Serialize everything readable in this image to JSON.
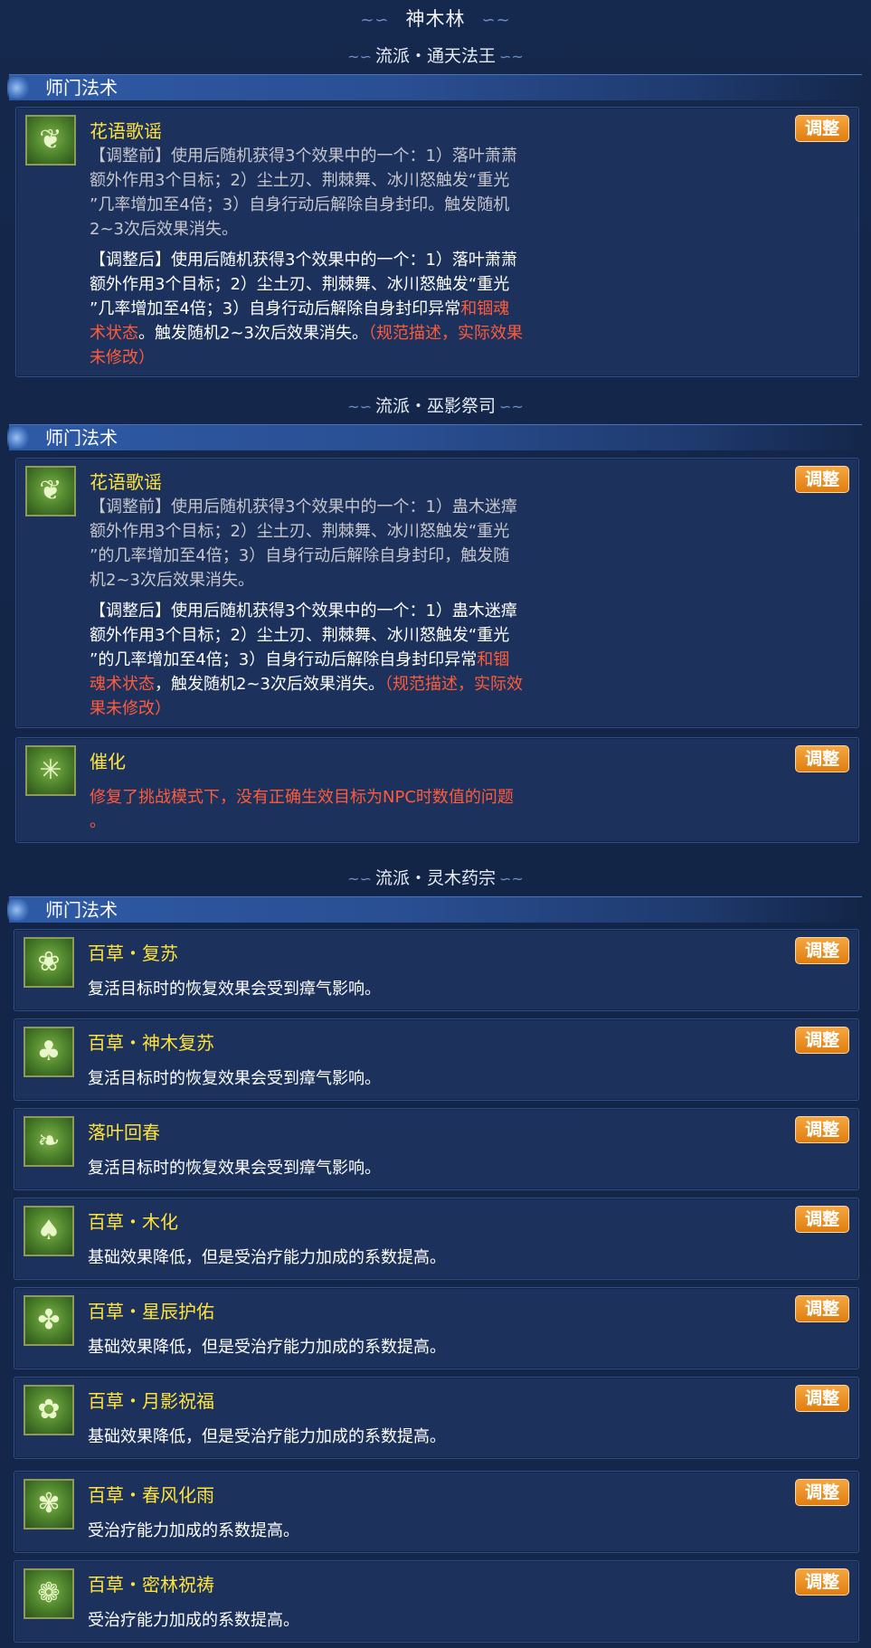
{
  "page_title": "神木林",
  "sections": [
    {
      "school": "流派・通天法王",
      "category": "师门法术",
      "skills": [
        {
          "name": "花语歌谣",
          "badge": "调整",
          "before_lines": [
            "【调整前】使用后随机获得3个效果中的一个：1）落叶萧萧",
            "额外作用3个目标；2）尘土刃、荆棘舞、冰川怒触发“重光",
            "”几率增加至4倍；3）自身行动后解除自身封印。触发随机",
            "2~3次后效果消失。"
          ],
          "after_lines": [
            "【调整后】使用后随机获得3个效果中的一个：1）落叶萧萧",
            "额外作用3个目标；2）尘土刃、荆棘舞、冰川怒触发“重光",
            "”几率增加至4倍；3）自身行动后解除自身封印异常"
          ],
          "after_red1": "和锢魂",
          "after_red2": "术状态",
          "after_tail": "。触发随机2~3次后效果消失。",
          "after_red3": "（规范描述，实际效果",
          "after_red4": "未修改）"
        }
      ]
    },
    {
      "school": "流派・巫影祭司",
      "category": "师门法术",
      "skills": [
        {
          "name": "花语歌谣",
          "badge": "调整",
          "before_lines": [
            "【调整前】使用后随机获得3个效果中的一个：1）蛊木迷瘴",
            "额外作用3个目标；2）尘土刃、荆棘舞、冰川怒触发“重光",
            "”的几率增加至4倍；3）自身行动后解除自身封印，触发随",
            "机2~3次后效果消失。"
          ],
          "after_lines": [
            "【调整后】使用后随机获得3个效果中的一个：1）蛊木迷瘴",
            "额外作用3个目标；2）尘土刃、荆棘舞、冰川怒触发“重光",
            "”的几率增加至4倍；3）自身行动后解除自身封印异常"
          ],
          "after_red1": "和锢",
          "after_red2": "魂术状态",
          "after_tail": "，触发随机2~3次后效果消失。",
          "after_red3": "（规范描述，实际效",
          "after_red4": "果未修改）"
        },
        {
          "name": "催化",
          "badge": "调整",
          "red_lines": [
            "修复了挑战模式下，没有正确生效目标为NPC时数值的问题",
            "。"
          ]
        }
      ]
    },
    {
      "school": "流派・灵木药宗",
      "category": "师门法术",
      "skills": [
        {
          "name": "百草・复苏",
          "badge": "调整",
          "desc": "复活目标时的恢复效果会受到瘴气影响。",
          "icon": "sprout-icon"
        },
        {
          "name": "百草・神木复苏",
          "badge": "调整",
          "desc": "复活目标时的恢复效果会受到瘴气影响。",
          "icon": "tree-icon"
        },
        {
          "name": "落叶回春",
          "badge": "调整",
          "desc": "复活目标时的恢复效果会受到瘴气影响。",
          "icon": "leaf-drop-icon"
        },
        {
          "name": "百草・木化",
          "badge": "调整",
          "desc": "基础效果降低，但是受治疗能力加成的系数提高。",
          "icon": "tree-circle-icon"
        },
        {
          "name": "百草・星辰护佑",
          "badge": "调整",
          "desc": "基础效果降低，但是受治疗能力加成的系数提高。",
          "icon": "trefoil-icon"
        },
        {
          "name": "百草・月影祝福",
          "badge": "调整",
          "desc": "基础效果降低，但是受治疗能力加成的系数提高。",
          "icon": "clover-icon"
        },
        {
          "name": "百草・春风化雨",
          "badge": "调整",
          "desc": "受治疗能力加成的系数提高。",
          "icon": "flower-icon"
        },
        {
          "name": "百草・密林祝祷",
          "badge": "调整",
          "desc": "受治疗能力加成的系数提高。",
          "icon": "vine-icon"
        }
      ]
    }
  ]
}
